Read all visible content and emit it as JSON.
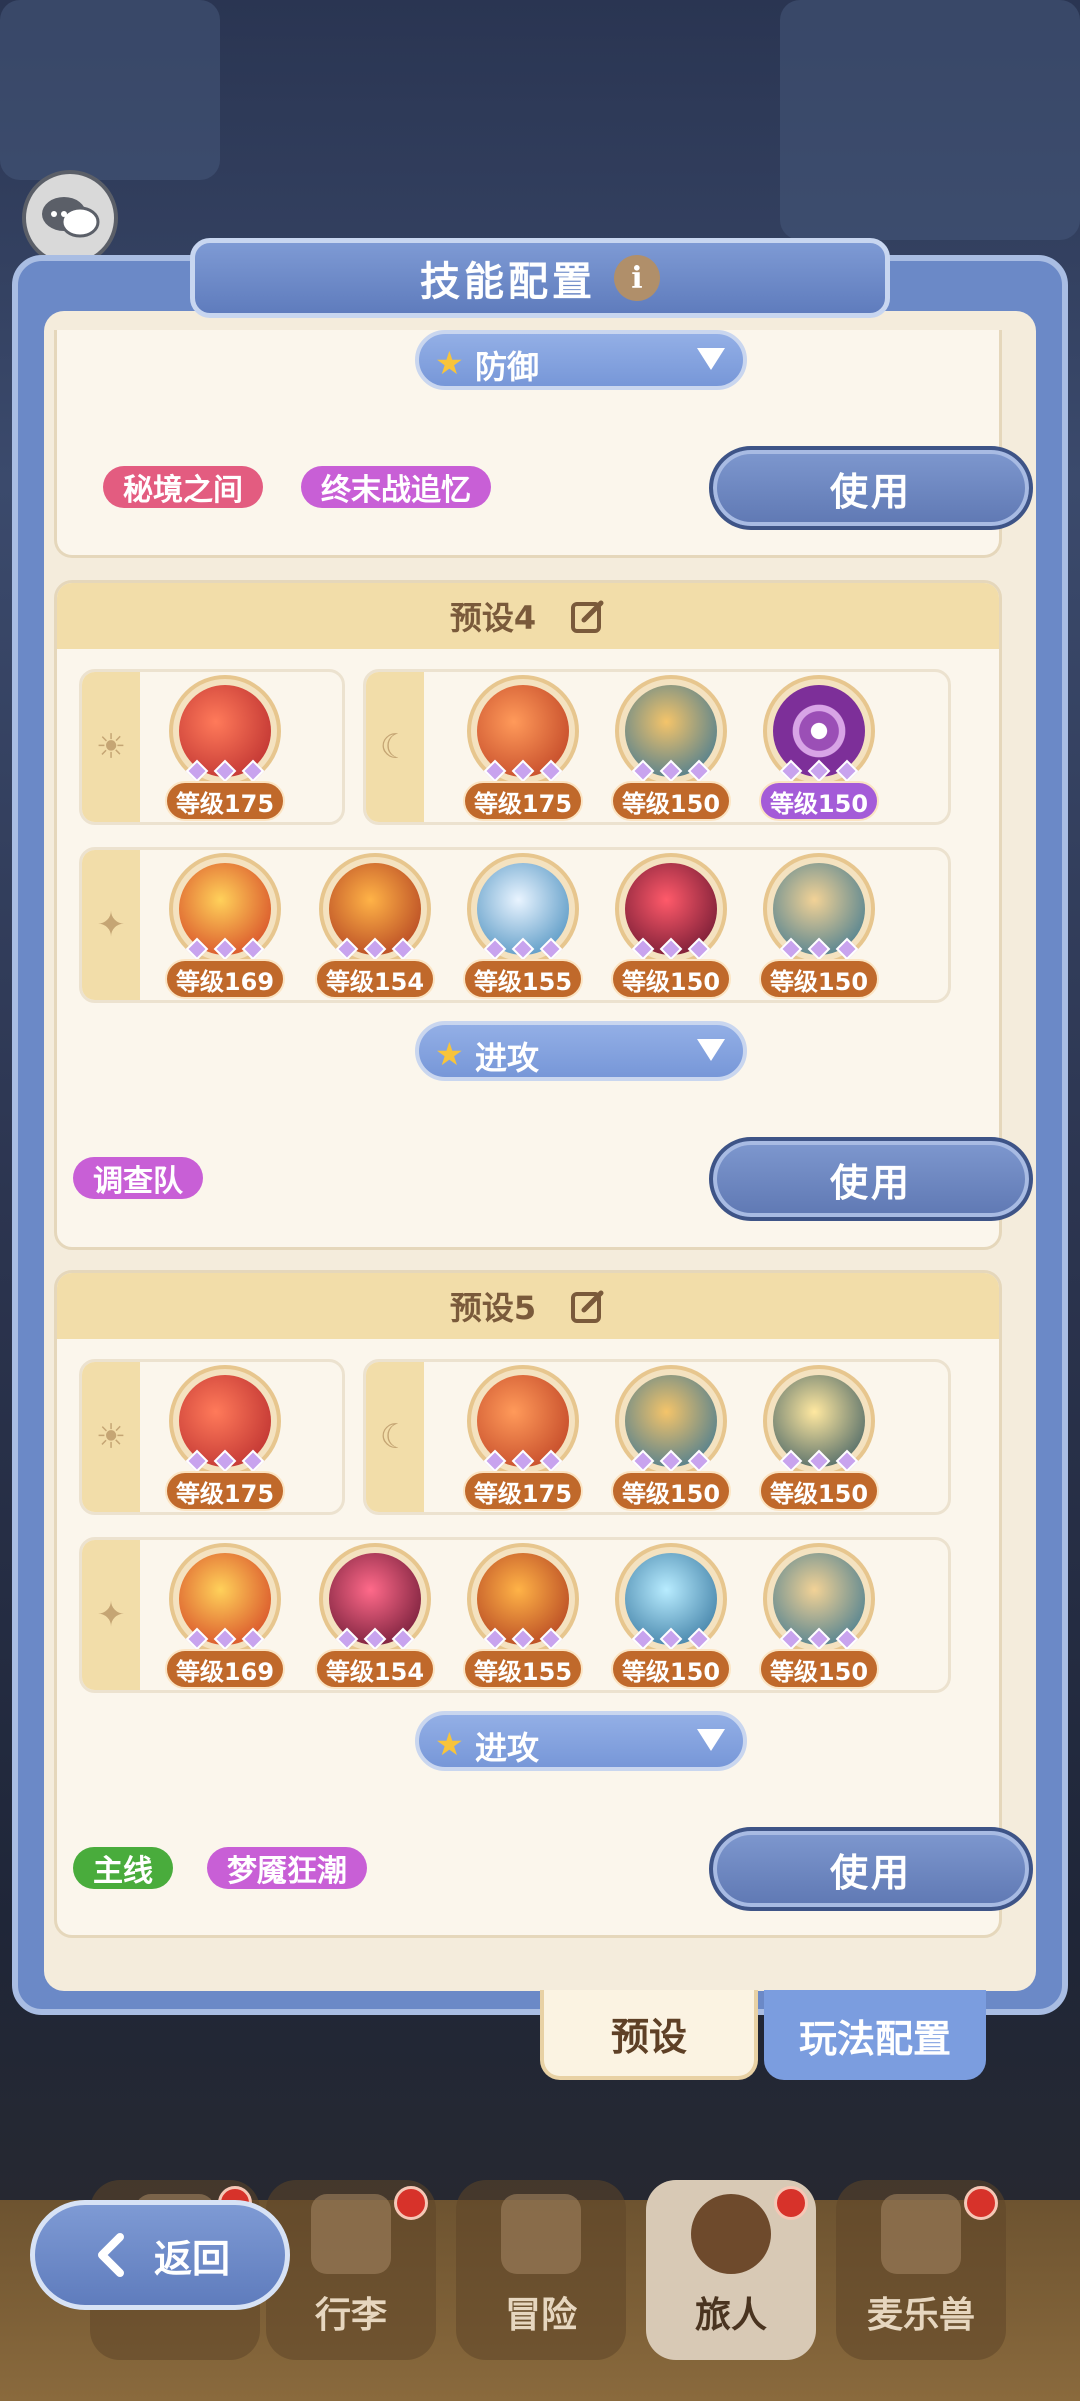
{
  "title": "技能配置",
  "top_card": {
    "select": "防御",
    "tags": [
      "秘境之间",
      "终末战追忆"
    ],
    "use_label": "使用"
  },
  "preset4": {
    "name": "预设4",
    "sun_skills": [
      "等级175"
    ],
    "moon_skills": [
      "等级175",
      "等级150",
      "等级150"
    ],
    "star_skills": [
      "等级169",
      "等级154",
      "等级155",
      "等级150",
      "等级150"
    ],
    "select": "进攻",
    "tags": [
      "调查队"
    ],
    "use_label": "使用"
  },
  "preset5": {
    "name": "预设5",
    "sun_skills": [
      "等级175"
    ],
    "moon_skills": [
      "等级175",
      "等级150",
      "等级150"
    ],
    "star_skills": [
      "等级169",
      "等级154",
      "等级155",
      "等级150",
      "等级150"
    ],
    "select": "进攻",
    "tags": [
      "主线",
      "梦魇狂潮"
    ],
    "use_label": "使用"
  },
  "tabs": {
    "preset": "预设",
    "play_config": "玩法配置"
  },
  "back_label": "返回",
  "nav": [
    "行李",
    "冒险",
    "旅人",
    "麦乐兽"
  ],
  "colors": {
    "panel": "#6b89c7",
    "card_header": "#f2dda9",
    "level_badge": "#c0692b",
    "level_badge_purple": "#a45bd8"
  }
}
